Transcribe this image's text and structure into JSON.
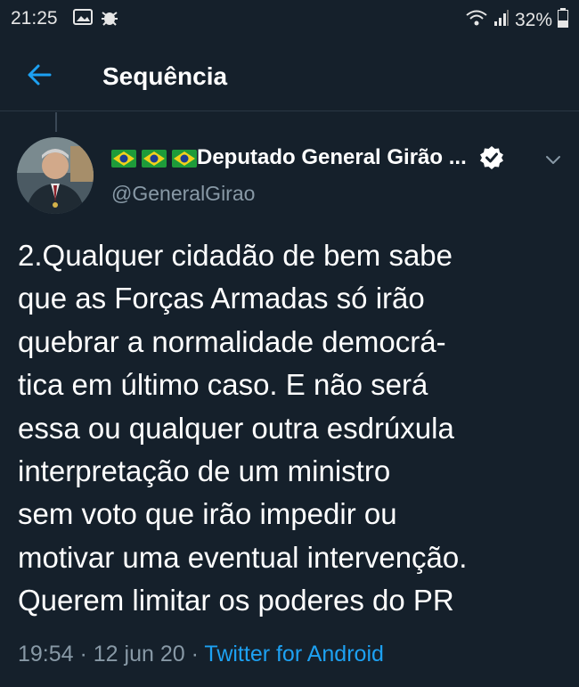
{
  "status_bar": {
    "time": "21:25",
    "battery": "32%"
  },
  "header": {
    "title": "Sequência"
  },
  "tweet": {
    "author_flags": [
      "flag-brazil-icon",
      "flag-brazil-icon",
      "flag-brazil-icon"
    ],
    "author_name": "Deputado General Girão ...",
    "handle": "@GeneralGirao",
    "text_lines": [
      "2.Qualquer cidadão de bem sabe",
      "que as Forças Armadas só irão",
      "quebrar a normalidade democrá-",
      "tica em último caso. E não será",
      "essa ou qualquer outra esdrúxula",
      "interpretação de um ministro",
      "sem voto que irão impedir ou",
      "motivar uma eventual intervenção.",
      "Querem limitar os poderes do PR"
    ],
    "time": "19:54",
    "separator": " · ",
    "date": "12 jun 20",
    "source": "Twitter for Android"
  },
  "colors": {
    "background": "#15202b",
    "accent": "#1da1f2",
    "secondary_text": "#8899a6"
  }
}
